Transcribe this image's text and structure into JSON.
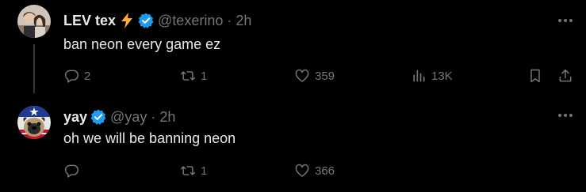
{
  "tweets": [
    {
      "name": "LEV tex",
      "handle": "@texerino",
      "separator": "·",
      "time": "2h",
      "text": "ban neon every game ez",
      "replies": "2",
      "retweets": "1",
      "likes": "359",
      "views": "13K",
      "icons": [
        "reply-icon",
        "retweet-icon",
        "like-icon",
        "views-icon",
        "bookmark-icon",
        "share-icon"
      ]
    },
    {
      "name": "yay",
      "handle": "@yay",
      "separator": "·",
      "time": "2h",
      "text": "oh we will be banning neon",
      "replies": "",
      "retweets": "1",
      "likes": "366",
      "icons": [
        "reply-icon",
        "retweet-icon",
        "like-icon"
      ]
    }
  ],
  "colors": {
    "background": "#000000",
    "text": "#e7e9ea",
    "muted": "#71767b",
    "verified": "#1d9bf0",
    "lightning": "#ffac33",
    "thread_line": "#333639"
  }
}
